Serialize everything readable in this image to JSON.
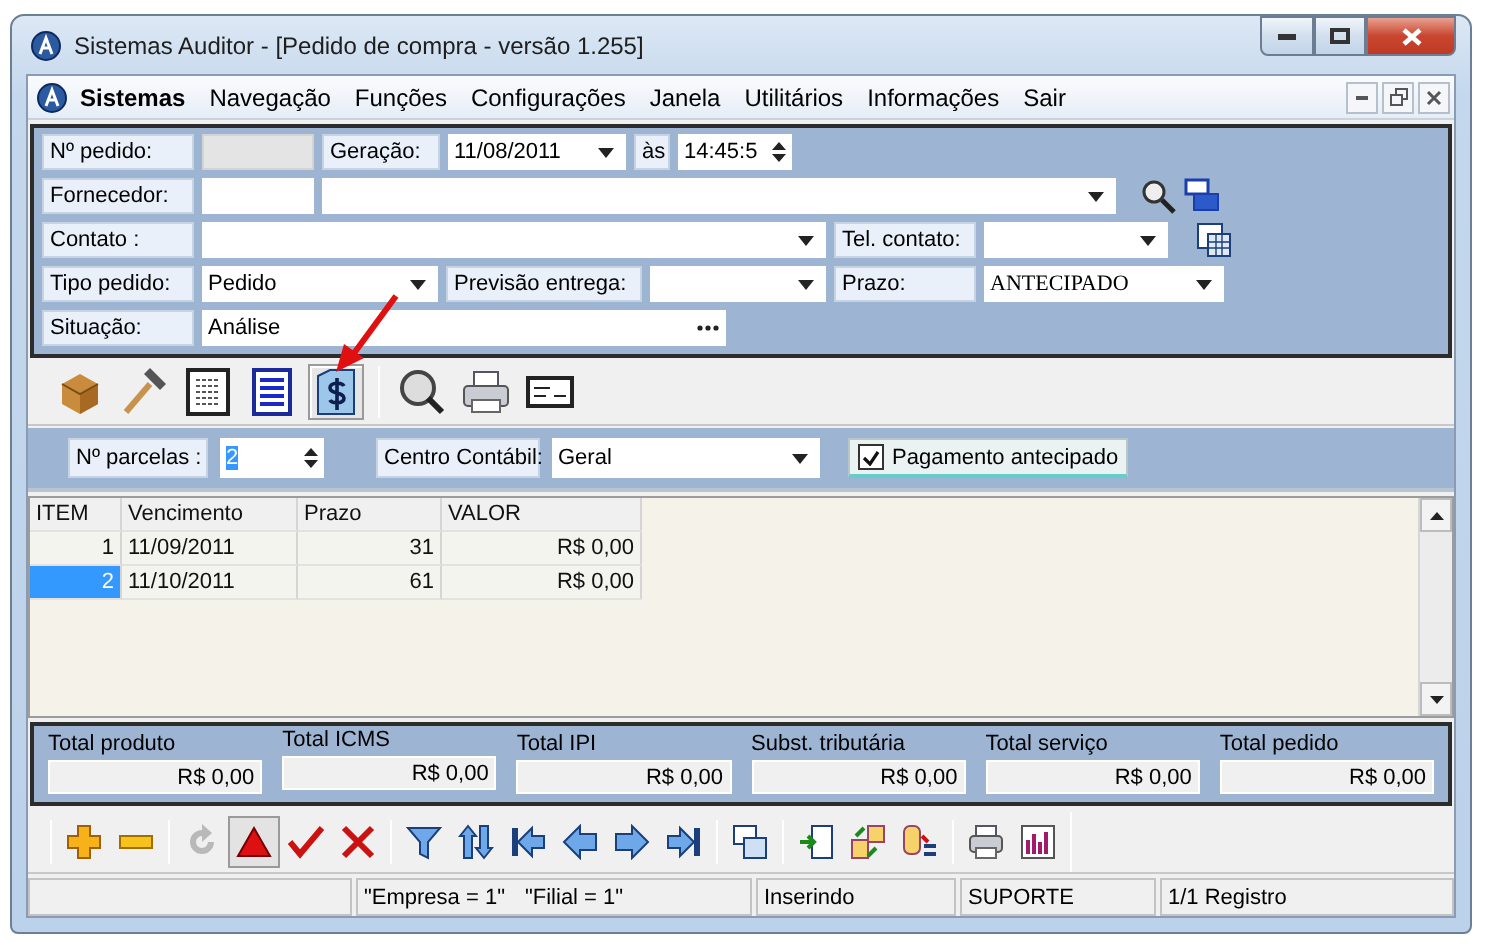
{
  "window": {
    "title": "Sistemas Auditor - [Pedido de compra - versão 1.255]"
  },
  "menu": {
    "brand": "Sistemas",
    "items": [
      "Navegação",
      "Funções",
      "Configurações",
      "Janela",
      "Utilitários",
      "Informações",
      "Sair"
    ]
  },
  "header": {
    "order_no": {
      "label": "Nº pedido:",
      "disabled": true
    },
    "generation": {
      "label": "Geração:",
      "date": "11/08/2011",
      "at_label": "às",
      "time": "14:45:5"
    },
    "supplier": {
      "label": "Fornecedor:"
    },
    "contact": {
      "label": "Contato :"
    },
    "phone": {
      "label": "Tel. contato:"
    },
    "order_type": {
      "label": "Tipo pedido:",
      "value": "Pedido"
    },
    "delivery": {
      "label": "Previsão entrega:"
    },
    "term": {
      "label": "Prazo:",
      "value": "ANTECIPADO"
    },
    "status": {
      "label": "Situação:",
      "value": "Análise"
    }
  },
  "tabs": [
    {
      "kind": "box",
      "selected": false
    },
    {
      "kind": "hammer",
      "selected": false
    },
    {
      "kind": "document",
      "selected": false
    },
    {
      "kind": "list",
      "selected": false
    },
    {
      "kind": "money",
      "selected": true
    },
    {
      "kind": "search",
      "selected": false
    },
    {
      "kind": "printer",
      "selected": false
    },
    {
      "kind": "card",
      "selected": false
    }
  ],
  "installments": {
    "count_label": "Nº parcelas :",
    "count": "2",
    "center_label": "Centro Contábil:",
    "center": "Geral",
    "prepaid": {
      "label": "Pagamento antecipado",
      "checked": true
    }
  },
  "table": {
    "columns": [
      "ITEM",
      "Vencimento",
      "Prazo",
      "VALOR"
    ],
    "rows": [
      {
        "item": "1",
        "due": "11/09/2011",
        "term": "31",
        "value": "R$ 0,00",
        "selected": false
      },
      {
        "item": "2",
        "due": "11/10/2011",
        "term": "61",
        "value": "R$ 0,00",
        "selected": true
      }
    ]
  },
  "totals": [
    {
      "label": "Total produto",
      "value": "R$ 0,00"
    },
    {
      "label": "Total ICMS",
      "value": "R$ 0,00"
    },
    {
      "label": "Total IPI",
      "value": "R$ 0,00"
    },
    {
      "label": "Subst. tributária",
      "value": "R$ 0,00"
    },
    {
      "label": "Total serviço",
      "value": "R$ 0,00"
    },
    {
      "label": "Total pedido",
      "value": "R$ 0,00"
    }
  ],
  "toolbar": [
    {
      "buttons": [
        {
          "kind": "add",
          "disabled": false,
          "pressed": false
        },
        {
          "kind": "remove",
          "disabled": false,
          "pressed": false
        }
      ]
    },
    {
      "buttons": [
        {
          "kind": "refresh",
          "disabled": true,
          "pressed": false
        },
        {
          "kind": "triangle",
          "disabled": false,
          "pressed": true
        },
        {
          "kind": "check",
          "disabled": false,
          "pressed": false
        },
        {
          "kind": "cancel",
          "disabled": false,
          "pressed": false
        }
      ]
    },
    {
      "buttons": [
        {
          "kind": "filter",
          "disabled": false,
          "pressed": false
        },
        {
          "kind": "sort",
          "disabled": false,
          "pressed": false
        },
        {
          "kind": "first",
          "disabled": false,
          "pressed": false
        },
        {
          "kind": "prev",
          "disabled": false,
          "pressed": false
        },
        {
          "kind": "next",
          "disabled": false,
          "pressed": false
        },
        {
          "kind": "last",
          "disabled": false,
          "pressed": false
        }
      ]
    },
    {
      "buttons": [
        {
          "kind": "windows",
          "disabled": false,
          "pressed": false
        }
      ]
    },
    {
      "buttons": [
        {
          "kind": "import",
          "disabled": false,
          "pressed": false
        },
        {
          "kind": "transfer",
          "disabled": false,
          "pressed": false
        },
        {
          "kind": "query",
          "disabled": false,
          "pressed": false
        }
      ]
    },
    {
      "buttons": [
        {
          "kind": "print",
          "disabled": false,
          "pressed": false
        },
        {
          "kind": "chart",
          "disabled": false,
          "pressed": false
        }
      ]
    }
  ],
  "status_bar": {
    "company": "\"Empresa = 1\"",
    "branch": "\"Filial = 1\"",
    "mode": "Inserindo",
    "user": "SUPORTE",
    "records": "1/1 Registro"
  }
}
